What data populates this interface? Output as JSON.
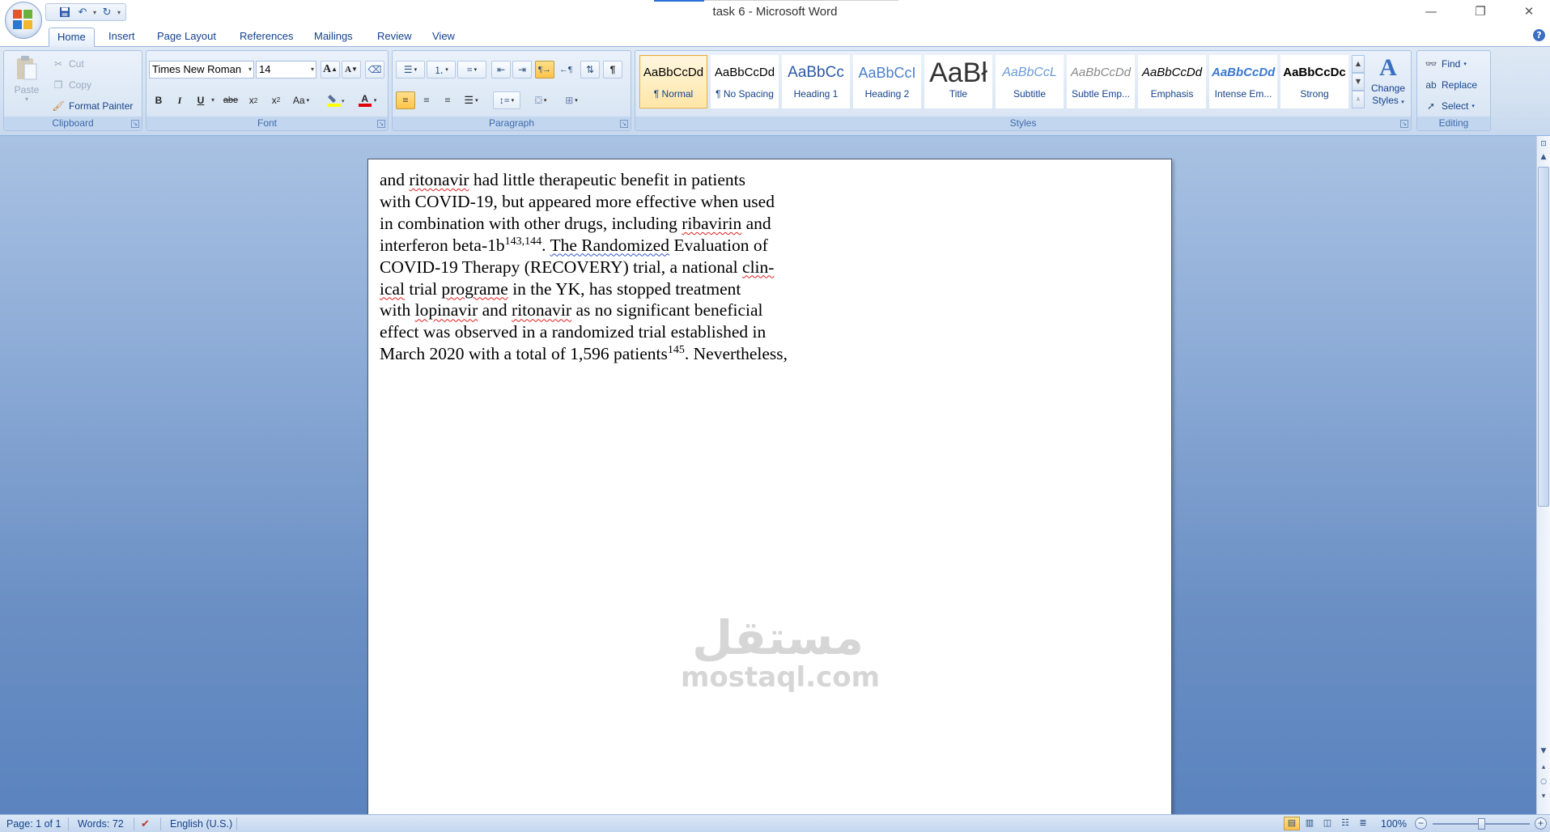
{
  "window": {
    "title": "task 6 - Microsoft Word",
    "minimize": "—",
    "restore": "❐",
    "close": "✕"
  },
  "tabs": [
    "Home",
    "Insert",
    "Page Layout",
    "References",
    "Mailings",
    "Review",
    "View"
  ],
  "active_tab": "Home",
  "help": "?",
  "clipboard": {
    "paste": "Paste",
    "cut": "Cut",
    "copy": "Copy",
    "format_painter": "Format Painter",
    "label": "Clipboard"
  },
  "font": {
    "family": "Times New Roman",
    "size": "14",
    "grow": "A",
    "shrink": "A",
    "bold": "B",
    "italic": "I",
    "underline": "U",
    "strike": "abe",
    "subscript": "x",
    "superscript": "x",
    "change_case": "Aa",
    "font_color": "A",
    "label": "Font"
  },
  "paragraph": {
    "label": "Paragraph",
    "show_marks": "¶"
  },
  "styles": {
    "label": "Styles",
    "items": [
      {
        "preview": "AaBbCcDd",
        "name": "¶ Normal"
      },
      {
        "preview": "AaBbCcDd",
        "name": "¶ No Spacing"
      },
      {
        "preview": "AaBbCc",
        "name": "Heading 1"
      },
      {
        "preview": "AaBbCcI",
        "name": "Heading 2"
      },
      {
        "preview": "AaBł",
        "name": "Title"
      },
      {
        "preview": "AaBbCcL",
        "name": "Subtitle"
      },
      {
        "preview": "AaBbCcDd",
        "name": "Subtle Emp..."
      },
      {
        "preview": "AaBbCcDd",
        "name": "Emphasis"
      },
      {
        "preview": "AaBbCcDd",
        "name": "Intense Em..."
      },
      {
        "preview": "AaBbCcDc",
        "name": "Strong"
      }
    ],
    "change_styles": [
      "Change",
      "Styles"
    ]
  },
  "editing": {
    "find": "Find",
    "replace": "Replace",
    "select": "Select",
    "label": "Editing"
  },
  "document": {
    "lines": [
      [
        "and ",
        "ritonavir",
        " had little therapeutic benefit in patients"
      ],
      [
        "with COVID-19, but appeared more effective when used"
      ],
      [
        "in combination with other drugs, including ",
        "ribavirin",
        " and"
      ],
      [
        "interferon beta-1b",
        "143,144",
        ". ",
        "The Randomized",
        " Evaluation of"
      ],
      [
        "COVID-19 Therapy (RECOVERY) trial, a national ",
        "clin-"
      ],
      [
        "ical",
        " trial ",
        "programe",
        " in the YK, has stopped treatment"
      ],
      [
        "with ",
        "lopinavir",
        " and ",
        "ritonavir",
        " as no significant beneficial"
      ],
      [
        "effect was observed in a randomized trial established in"
      ],
      [
        "March 2020 with a total of 1,596 patients",
        "145",
        ". Nevertheless,"
      ]
    ]
  },
  "watermark": {
    "arabic": "مستقل",
    "latin": "mostaql.com"
  },
  "status": {
    "page": "Page: 1 of 1",
    "words": "Words: 72",
    "language": "English (U.S.)",
    "zoom": "100%"
  }
}
